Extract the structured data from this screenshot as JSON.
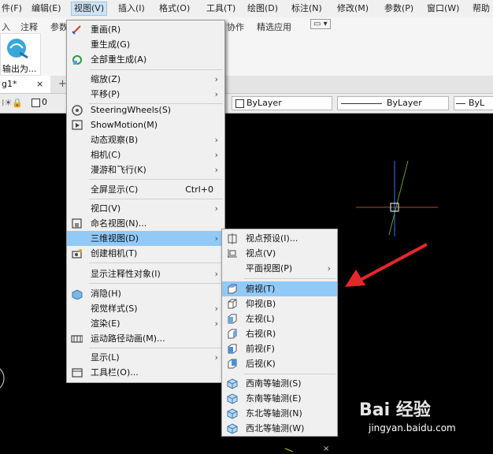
{
  "menubar": {
    "items": [
      "件(F)",
      "编辑(E)",
      "视图(V)",
      "插入(I)",
      "格式(O)",
      "工具(T)",
      "绘图(D)",
      "标注(N)",
      "修改(M)",
      "参数(P)",
      "窗口(W)",
      "帮助("
    ]
  },
  "ribbon": {
    "tabs": [
      "入",
      "注释",
      "参数"
    ],
    "right_tabs": [
      "协作",
      "精选应用"
    ],
    "export_label": "输出为..."
  },
  "doc_tab": {
    "label": "g1*",
    "close": "×",
    "add": "+"
  },
  "props": {
    "layer": "0",
    "color": "ByLayer",
    "linetype": "ByLayer",
    "lineweight": "ByL"
  },
  "view_menu": {
    "items": [
      {
        "label": "重画(R)"
      },
      {
        "label": "重生成(G)"
      },
      {
        "label": "全部重生成(A)"
      },
      {
        "label": "缩放(Z)",
        "submenu": true
      },
      {
        "label": "平移(P)",
        "submenu": true
      },
      {
        "label": "SteeringWheels(S)"
      },
      {
        "label": "ShowMotion(M)"
      },
      {
        "label": "动态观察(B)",
        "submenu": true
      },
      {
        "label": "相机(C)",
        "submenu": true
      },
      {
        "label": "漫游和飞行(K)",
        "submenu": true
      },
      {
        "label": "全屏显示(C)",
        "shortcut": "Ctrl+0"
      },
      {
        "label": "视口(V)",
        "submenu": true
      },
      {
        "label": "命名视图(N)..."
      },
      {
        "label": "三维视图(D)",
        "submenu": true
      },
      {
        "label": "创建相机(T)"
      },
      {
        "label": "显示注释性对象(I)",
        "submenu": true
      },
      {
        "label": "消隐(H)"
      },
      {
        "label": "视觉样式(S)",
        "submenu": true
      },
      {
        "label": "渲染(E)",
        "submenu": true
      },
      {
        "label": "运动路径动画(M)..."
      },
      {
        "label": "显示(L)",
        "submenu": true
      },
      {
        "label": "工具栏(O)..."
      }
    ]
  },
  "view3d_menu": {
    "items": [
      {
        "label": "视点预设(I)..."
      },
      {
        "label": "视点(V)"
      },
      {
        "label": "平面视图(P)",
        "submenu": true
      },
      {
        "label": "俯视(T)"
      },
      {
        "label": "仰视(B)"
      },
      {
        "label": "左视(L)"
      },
      {
        "label": "右视(R)"
      },
      {
        "label": "前视(F)"
      },
      {
        "label": "后视(K)"
      },
      {
        "label": "西南等轴测(S)"
      },
      {
        "label": "东南等轴测(E)"
      },
      {
        "label": "东北等轴测(N)"
      },
      {
        "label": "西北等轴测(W)"
      }
    ]
  },
  "watermark": {
    "line1": "Bai 经验",
    "line2": "jingyan.baidu.com"
  },
  "colors": {
    "highlight": "#91c9f7",
    "arrow": "#e8262a",
    "menu_bg": "#f0f0f0"
  },
  "arrow_glyph": "▶"
}
